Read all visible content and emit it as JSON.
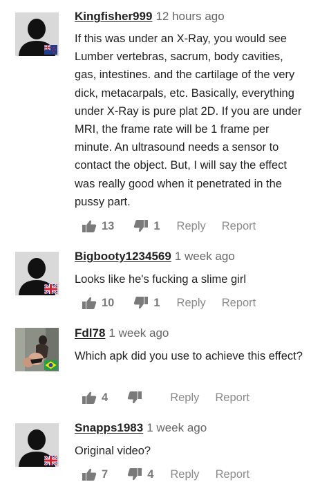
{
  "comments": [
    {
      "username": "Kingfisher999",
      "time": "12 hours ago",
      "flag": "new-zealand",
      "text": "If this was under an X-Ray, you would see Lumber vertebras, sacrum, body cavities, gas, intestines. and the cartilage of the very dick, metacarpals, etc. Basically, everything under X-Ray is pure plat 2D. If you are under MRI, the frame rate will be 1 frame per minute. An ultrasound needs a sensor to contact the object. But, I will say the effect was really good when it penetrated in the pussy part.",
      "likes": "13",
      "dislikes": "1",
      "reply_label": "Reply",
      "report_label": "Report"
    },
    {
      "username": "Bigbooty1234569",
      "time": "1 week ago",
      "flag": "united-kingdom",
      "text": "Looks like he's fucking a slime girl",
      "likes": "10",
      "dislikes": "1",
      "reply_label": "Reply",
      "report_label": "Report"
    },
    {
      "username": "Fdl78",
      "time": "1 week ago",
      "flag": "brazil",
      "text": "Which apk did you use to achieve this effect?",
      "likes": "4",
      "dislikes": "",
      "reply_label": "Reply",
      "report_label": "Report"
    },
    {
      "username": "Snapps1983",
      "time": "1 week ago",
      "flag": "united-kingdom",
      "text": "Original video?",
      "likes": "7",
      "dislikes": "4",
      "reply_label": "Reply",
      "report_label": "Report"
    }
  ],
  "icons": {
    "like": "thumbs-up-icon",
    "dislike": "thumbs-down-icon",
    "default_avatar": "default-avatar-silhouette",
    "photo_avatar": "user-photo-avatar"
  },
  "colors": {
    "username": "#222222",
    "meta": "#666666",
    "actions": "#7a7a7a",
    "avatar_bg": "#d9d9d9",
    "avatar_silhouette": "#111111"
  }
}
